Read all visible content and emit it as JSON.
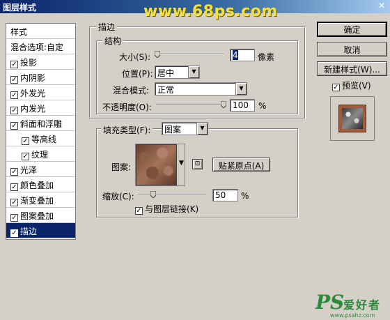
{
  "window": {
    "title": "图层样式",
    "watermark": "www.68ps.com"
  },
  "stylelist": {
    "header": "样式",
    "blend_options": "混合选项:自定",
    "items": [
      {
        "label": "投影",
        "checked": true
      },
      {
        "label": "内阴影",
        "checked": true
      },
      {
        "label": "外发光",
        "checked": true
      },
      {
        "label": "内发光",
        "checked": true
      },
      {
        "label": "斜面和浮雕",
        "checked": true
      },
      {
        "label": "等高线",
        "checked": true
      },
      {
        "label": "纹理",
        "checked": true
      },
      {
        "label": "光泽",
        "checked": true
      },
      {
        "label": "颜色叠加",
        "checked": true
      },
      {
        "label": "渐变叠加",
        "checked": true
      },
      {
        "label": "图案叠加",
        "checked": true
      },
      {
        "label": "描边",
        "checked": true
      }
    ]
  },
  "stroke": {
    "group_title": "描边",
    "structure": {
      "title": "结构",
      "size_label": "大小(S):",
      "size_value": "4",
      "size_unit": "像素",
      "position_label": "位置(P):",
      "position_value": "居中",
      "blend_label": "混合模式:",
      "blend_value": "正常",
      "opacity_label": "不透明度(O):",
      "opacity_value": "100",
      "opacity_unit": "%"
    },
    "fill": {
      "type_label": "填充类型(F):",
      "type_value": "图案",
      "pattern_label": "图案:",
      "snap_button": "贴紧原点(A)",
      "scale_label": "缩放(C):",
      "scale_value": "50",
      "scale_unit": "%",
      "link_label": "与图层链接(K)",
      "link_checked": true
    }
  },
  "buttons": {
    "ok": "确定",
    "cancel": "取消",
    "new_style": "新建样式(W)...",
    "preview_label": "预览(V)",
    "preview_checked": true
  },
  "logo": {
    "text": "PS",
    "cn": "爱好者",
    "url": "www.psahz.com"
  }
}
